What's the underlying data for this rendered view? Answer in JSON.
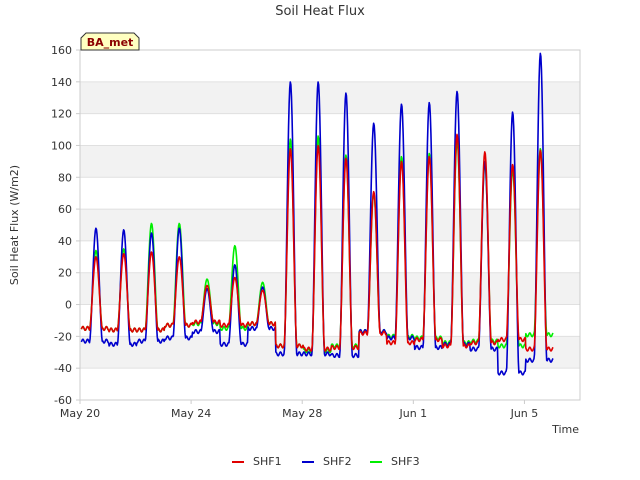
{
  "chart_data": {
    "type": "line",
    "title": "Soil Heat Flux",
    "xlabel": "Time",
    "ylabel": "Soil Heat Flux (W/m2)",
    "badge": "BA_met",
    "xlim_days": [
      0,
      18
    ],
    "ylim": [
      -60,
      160
    ],
    "yticks": [
      -60,
      -40,
      -20,
      0,
      20,
      40,
      60,
      80,
      100,
      120,
      140,
      160
    ],
    "xticks": [
      {
        "label": "May 20",
        "day": 0
      },
      {
        "label": "May 24",
        "day": 4
      },
      {
        "label": "May 28",
        "day": 8
      },
      {
        "label": "Jun 1",
        "day": 12
      },
      {
        "label": "Jun 5",
        "day": 16
      }
    ],
    "grid_bands": true,
    "legend_position": "bottom-center",
    "series": [
      {
        "name": "SHF1",
        "color": "#e00000",
        "daily_peaks": [
          30,
          32,
          33,
          30,
          12,
          17,
          9,
          98,
          100,
          92,
          71,
          90,
          93,
          107,
          96,
          88,
          97
        ],
        "daily_troughs": [
          -15,
          -16,
          -16,
          -13,
          -11,
          -13,
          -12,
          -26,
          -28,
          -27,
          -18,
          -24,
          -22,
          -26,
          -24,
          -22,
          -28
        ]
      },
      {
        "name": "SHF2",
        "color": "#0000cc",
        "daily_peaks": [
          48,
          47,
          45,
          48,
          10,
          25,
          11,
          140,
          140,
          133,
          114,
          126,
          127,
          134,
          90,
          121,
          158
        ],
        "daily_troughs": [
          -23,
          -25,
          -23,
          -21,
          -17,
          -25,
          -15,
          -31,
          -31,
          -32,
          -17,
          -21,
          -27,
          -25,
          -28,
          -43,
          -35
        ]
      },
      {
        "name": "SHF3",
        "color": "#00ee00",
        "daily_peaks": [
          34,
          35,
          51,
          51,
          16,
          37,
          14,
          104,
          106,
          94,
          70,
          93,
          95,
          103,
          89,
          85,
          98
        ],
        "daily_troughs": [
          -15,
          -16,
          -16,
          -13,
          -12,
          -15,
          -12,
          -26,
          -29,
          -26,
          -17,
          -20,
          -21,
          -24,
          -23,
          -26,
          -19
        ]
      }
    ]
  }
}
